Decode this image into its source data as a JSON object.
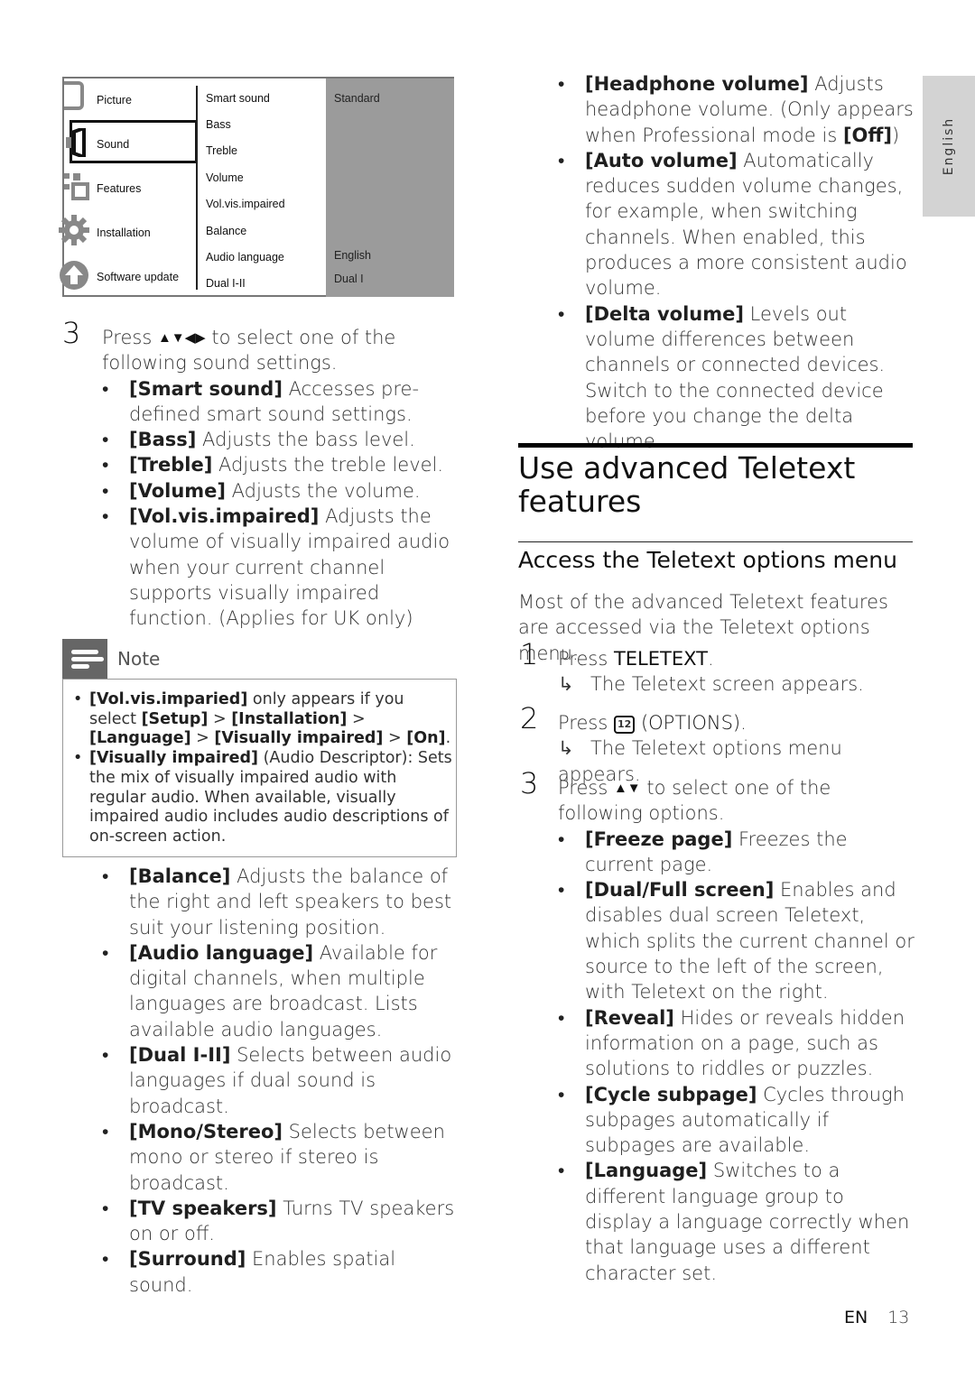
{
  "menu": {
    "categories": [
      {
        "label": "Picture",
        "icon": "picture-icon"
      },
      {
        "label": "Sound",
        "icon": "speaker-icon",
        "selected": true
      },
      {
        "label": "Features",
        "icon": "features-icon"
      },
      {
        "label": "Installation",
        "icon": "gear-icon"
      },
      {
        "label": "Software update",
        "icon": "upload-icon"
      }
    ],
    "options": [
      "Smart sound",
      "Bass",
      "Treble",
      "Volume",
      "Vol.vis.impaired",
      "Balance",
      "Audio language",
      "Dual I-II"
    ],
    "values": {
      "smart_sound": "Standard",
      "audio_language": "English",
      "dual": "Dual I"
    }
  },
  "left": {
    "step3": {
      "num": "3",
      "pre": "Press ",
      "keys": "▲▼◀▶",
      "post": " to select one of the following sound settings."
    },
    "items1": [
      {
        "term": "[Smart sound]",
        "desc": " Accesses pre-defined smart sound settings."
      },
      {
        "term": "[Bass]",
        "desc": " Adjusts the bass level."
      },
      {
        "term": "[Treble]",
        "desc": " Adjusts the treble level."
      },
      {
        "term": "[Volume]",
        "desc": " Adjusts the volume."
      },
      {
        "term": "[Vol.vis.impaired]",
        "desc": " Adjusts the volume of visually impaired audio when your current channel supports visually impaired function. (Applies for UK only)"
      }
    ],
    "note": {
      "label": "Note",
      "b1": {
        "t1": "[Vol.vis.imparied]",
        "d1": " only appears if you select ",
        "t2": "[Setup]",
        "d2": " > ",
        "t3": "[Installation]",
        "d3": " > ",
        "t4": "[Language]",
        "d4": " > ",
        "t5": "[Visually impaired]",
        "d5": " > ",
        "t6": "[On]",
        "d6": "."
      },
      "b2": {
        "term": "[Visually impaired]",
        "desc": " (Audio Descriptor): Sets the mix of visually impaired audio with regular audio. When available, visually impaired audio includes audio descriptions of on-screen action."
      }
    },
    "items2": [
      {
        "term": "[Balance]",
        "desc": " Adjusts the balance of the right and left speakers to best suit your listening position."
      },
      {
        "term": "[Audio language]",
        "desc": " Available for digital channels, when multiple languages are broadcast. Lists available audio languages."
      },
      {
        "term": "[Dual I-II]",
        "desc": " Selects between audio languages if dual sound is broadcast."
      },
      {
        "term": "[Mono/Stereo]",
        "desc": " Selects between mono or stereo if stereo is broadcast."
      },
      {
        "term": "[TV speakers]",
        "desc": " Turns TV speakers on or off."
      },
      {
        "term": "[Surround]",
        "desc": " Enables spatial sound."
      }
    ]
  },
  "right": {
    "items": [
      {
        "term": "[Headphone volume]",
        "desc": " Adjusts headphone volume. (Only appears when Professional mode is ",
        "term2": "[Off]",
        "desc2": ")"
      },
      {
        "term": "[Auto volume]",
        "desc": " Automatically reduces sudden volume changes, for example, when switching channels. When enabled, this produces a more consistent audio volume."
      },
      {
        "term": "[Delta volume]",
        "desc": " Levels out volume differences between channels or connected devices. Switch to the connected device before you change the delta volume."
      }
    ],
    "section_title": "Use advanced Teletext features",
    "subsection_title": "Access the Teletext options menu",
    "intro": "Most of the advanced Teletext features are accessed via the Teletext options menu.",
    "steps": [
      {
        "num": "1",
        "pre": "Press ",
        "key": "TELETEXT",
        "post": ".",
        "result": "The Teletext screen appears."
      },
      {
        "num": "2",
        "pre": "Press ",
        "keyicon": "12",
        "key": " (OPTIONS)",
        "post": ".",
        "result": "The Teletext options menu appears."
      },
      {
        "num": "3",
        "pre": "Press ",
        "keys": "▲▼",
        "post": " to select one of the following options."
      }
    ],
    "options": [
      {
        "term": "[Freeze page]",
        "desc": " Freezes the current page."
      },
      {
        "term": "[Dual/Full screen]",
        "desc": " Enables and disables dual screen Teletext, which splits the current channel or source to the left of the screen, with Teletext on the right."
      },
      {
        "term": "[Reveal]",
        "desc": " Hides or reveals hidden information on a page, such as solutions to riddles or puzzles."
      },
      {
        "term": "[Cycle subpage]",
        "desc": " Cycles through subpages automatically if subpages are available."
      },
      {
        "term": "[Language]",
        "desc": " Switches to a different language group to display a language correctly when that language uses a different character set."
      }
    ]
  },
  "side_tab": "English",
  "footer": {
    "lang": "EN",
    "page": "13"
  }
}
